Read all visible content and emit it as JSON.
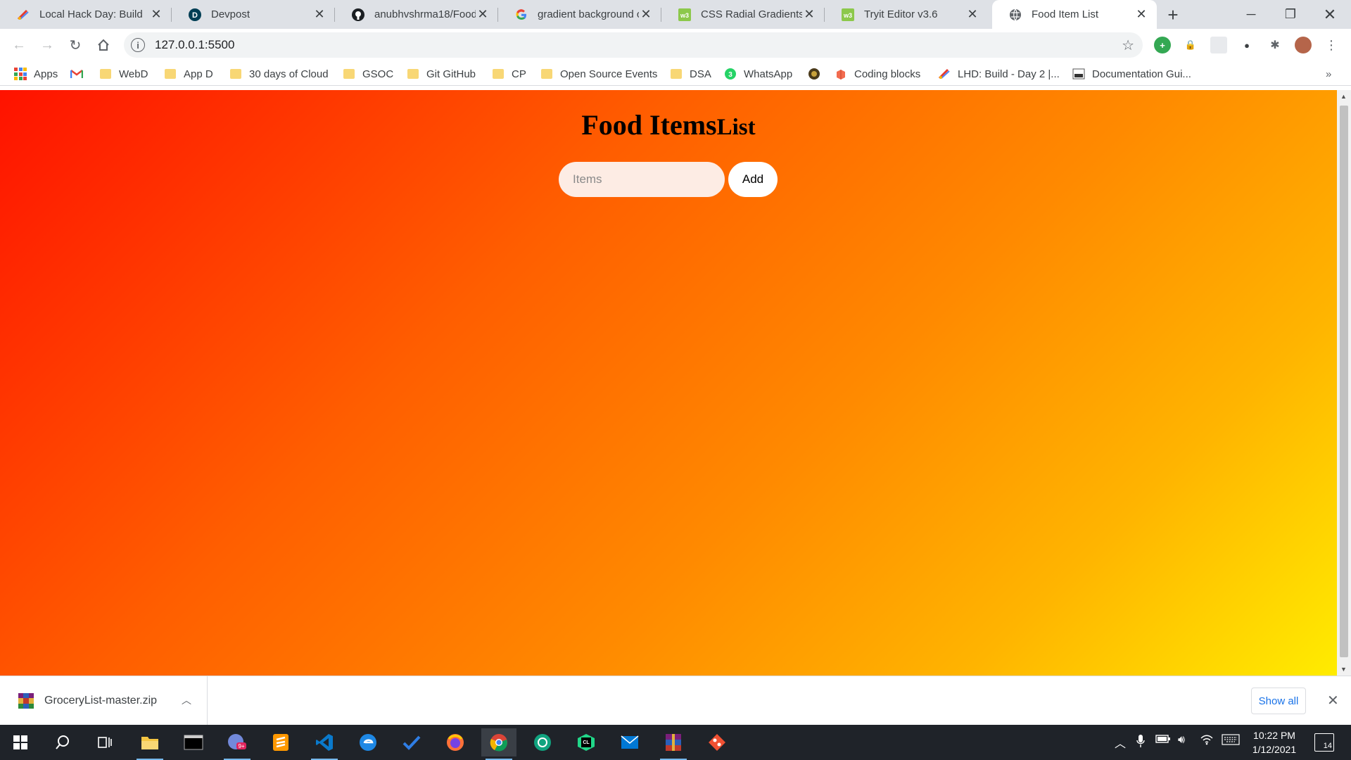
{
  "browser": {
    "tabs": [
      {
        "title": "Local Hack Day: Build",
        "icon": "mlh-icon",
        "active": false
      },
      {
        "title": "Devpost",
        "icon": "devpost-icon",
        "active": false
      },
      {
        "title": "anubhvshrma18/Food-",
        "icon": "github-icon",
        "active": false
      },
      {
        "title": "gradient background c",
        "icon": "google-icon",
        "active": false
      },
      {
        "title": "CSS Radial Gradients",
        "icon": "w3schools-icon",
        "active": false
      },
      {
        "title": "Tryit Editor v3.6",
        "icon": "w3schools-icon",
        "active": false
      },
      {
        "title": "Food Item List",
        "icon": "globe-icon",
        "active": true
      }
    ],
    "url": "127.0.0.1:5500"
  },
  "bookmarks": [
    {
      "label": "Apps",
      "icon": "apps-grid-icon"
    },
    {
      "label": "",
      "icon": "gmail-icon"
    },
    {
      "label": "WebD",
      "icon": "folder-icon"
    },
    {
      "label": "App D",
      "icon": "folder-icon"
    },
    {
      "label": "30 days of Cloud",
      "icon": "folder-icon"
    },
    {
      "label": "GSOC",
      "icon": "folder-icon"
    },
    {
      "label": "Git GitHub",
      "icon": "folder-icon"
    },
    {
      "label": "CP",
      "icon": "folder-icon"
    },
    {
      "label": "Open Source Events",
      "icon": "folder-icon"
    },
    {
      "label": "DSA",
      "icon": "folder-icon"
    },
    {
      "label": "WhatsApp",
      "icon": "whatsapp-icon"
    },
    {
      "label": "",
      "icon": "extension-bookmark-icon"
    },
    {
      "label": "Coding blocks",
      "icon": "coding-blocks-icon"
    },
    {
      "label": "LHD: Build - Day 2 |...",
      "icon": "mlh-icon"
    },
    {
      "label": "Documentation Gui...",
      "icon": "docs-icon"
    }
  ],
  "page": {
    "heading_part1": "Food Items",
    "heading_part2": "List",
    "input_placeholder": "Items",
    "add_label": "Add"
  },
  "downloads": {
    "file_name": "GroceryList-master.zip",
    "show_all_label": "Show all"
  },
  "taskbar": {
    "time": "10:22 PM",
    "date": "1/12/2021",
    "notification_count": "14",
    "badge": "9+"
  },
  "colors": {
    "gradient_start": "#ff1200",
    "gradient_end": "#ffee00",
    "link_blue": "#1a73e8"
  }
}
